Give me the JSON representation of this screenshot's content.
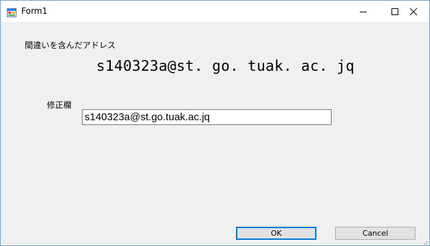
{
  "window": {
    "title": "Form1",
    "minimize_glyph": "—",
    "maximize_glyph": "☐",
    "close_glyph": "✕"
  },
  "form": {
    "wrong_address_label": "間違いを含んだアドレス",
    "wrong_address_value": "s140323a@st. go. tuak. ac. jq",
    "fix_label": "修正欄",
    "fix_input_value": "s140323a@st.go.tuak.ac.jq"
  },
  "buttons": {
    "ok_label": "OK",
    "cancel_label": "Cancel"
  },
  "colors": {
    "accent": "#0078d7",
    "form_background": "#f0f0f0"
  }
}
